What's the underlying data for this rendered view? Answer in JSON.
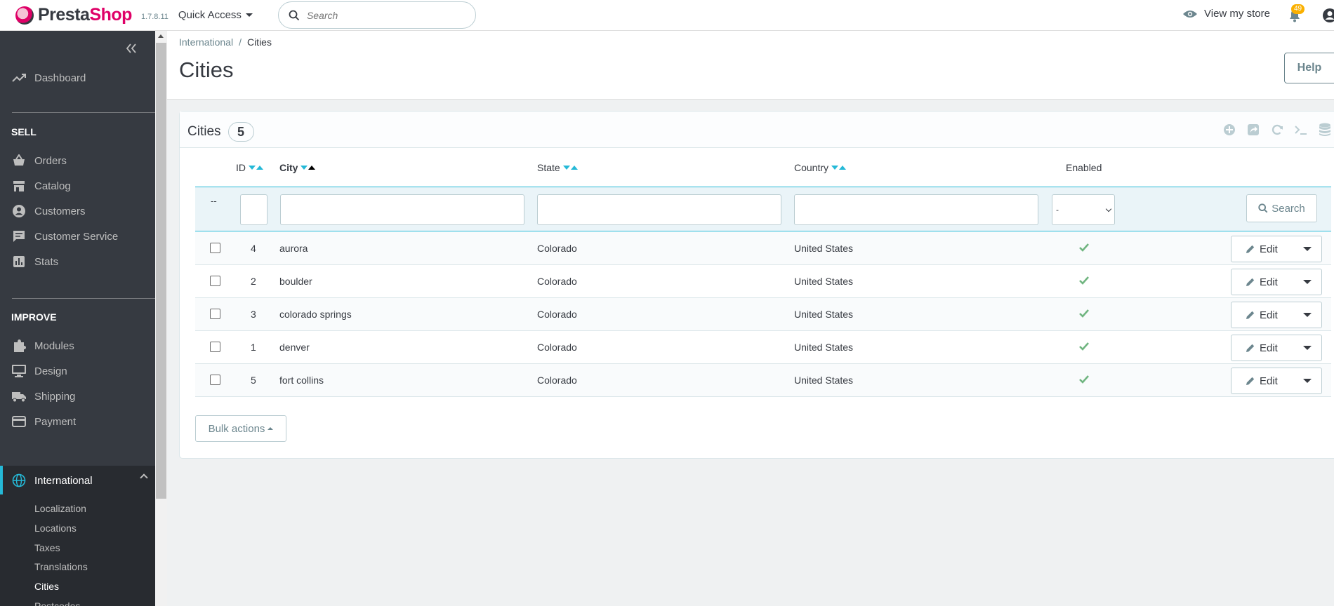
{
  "header": {
    "logo_text_a": "Presta",
    "logo_text_b": "Shop",
    "version": "1.7.8.11",
    "quick_access": "Quick Access",
    "search_placeholder": "Search",
    "view_store": "View my store",
    "notifications_count": "49"
  },
  "sidebar": {
    "dashboard": "Dashboard",
    "sections": {
      "sell": "SELL",
      "improve": "IMPROVE"
    },
    "sell_items": [
      "Orders",
      "Catalog",
      "Customers",
      "Customer Service",
      "Stats"
    ],
    "improve_items": [
      "Modules",
      "Design",
      "Shipping",
      "Payment",
      "International"
    ],
    "international_sub": [
      "Localization",
      "Locations",
      "Taxes",
      "Translations",
      "Cities",
      "Postcodes"
    ],
    "active_item": "International",
    "active_sub": "Cities"
  },
  "breadcrumb": {
    "parent": "International",
    "separator": "/",
    "current": "Cities"
  },
  "page": {
    "title": "Cities",
    "help": "Help"
  },
  "panel": {
    "title": "Cities",
    "count": "5"
  },
  "table": {
    "columns": {
      "id": "ID",
      "city": "City",
      "state": "State",
      "country": "Country",
      "enabled": "Enabled"
    },
    "filter_dash": "--",
    "enabled_filter_value": "-",
    "search_label": "Search",
    "edit_label": "Edit",
    "rows": [
      {
        "id": "4",
        "city": "aurora",
        "state": "Colorado",
        "country": "United States",
        "enabled": true
      },
      {
        "id": "2",
        "city": "boulder",
        "state": "Colorado",
        "country": "United States",
        "enabled": true
      },
      {
        "id": "3",
        "city": "colorado springs",
        "state": "Colorado",
        "country": "United States",
        "enabled": true
      },
      {
        "id": "1",
        "city": "denver",
        "state": "Colorado",
        "country": "United States",
        "enabled": true
      },
      {
        "id": "5",
        "city": "fort collins",
        "state": "Colorado",
        "country": "United States",
        "enabled": true
      }
    ]
  },
  "bulk_actions": "Bulk actions",
  "colors": {
    "accent": "#25b9d7",
    "sidebar_bg": "#363a41",
    "check_green": "#70b580",
    "logo_pink": "#df0067",
    "badge_yellow": "#fab000"
  }
}
